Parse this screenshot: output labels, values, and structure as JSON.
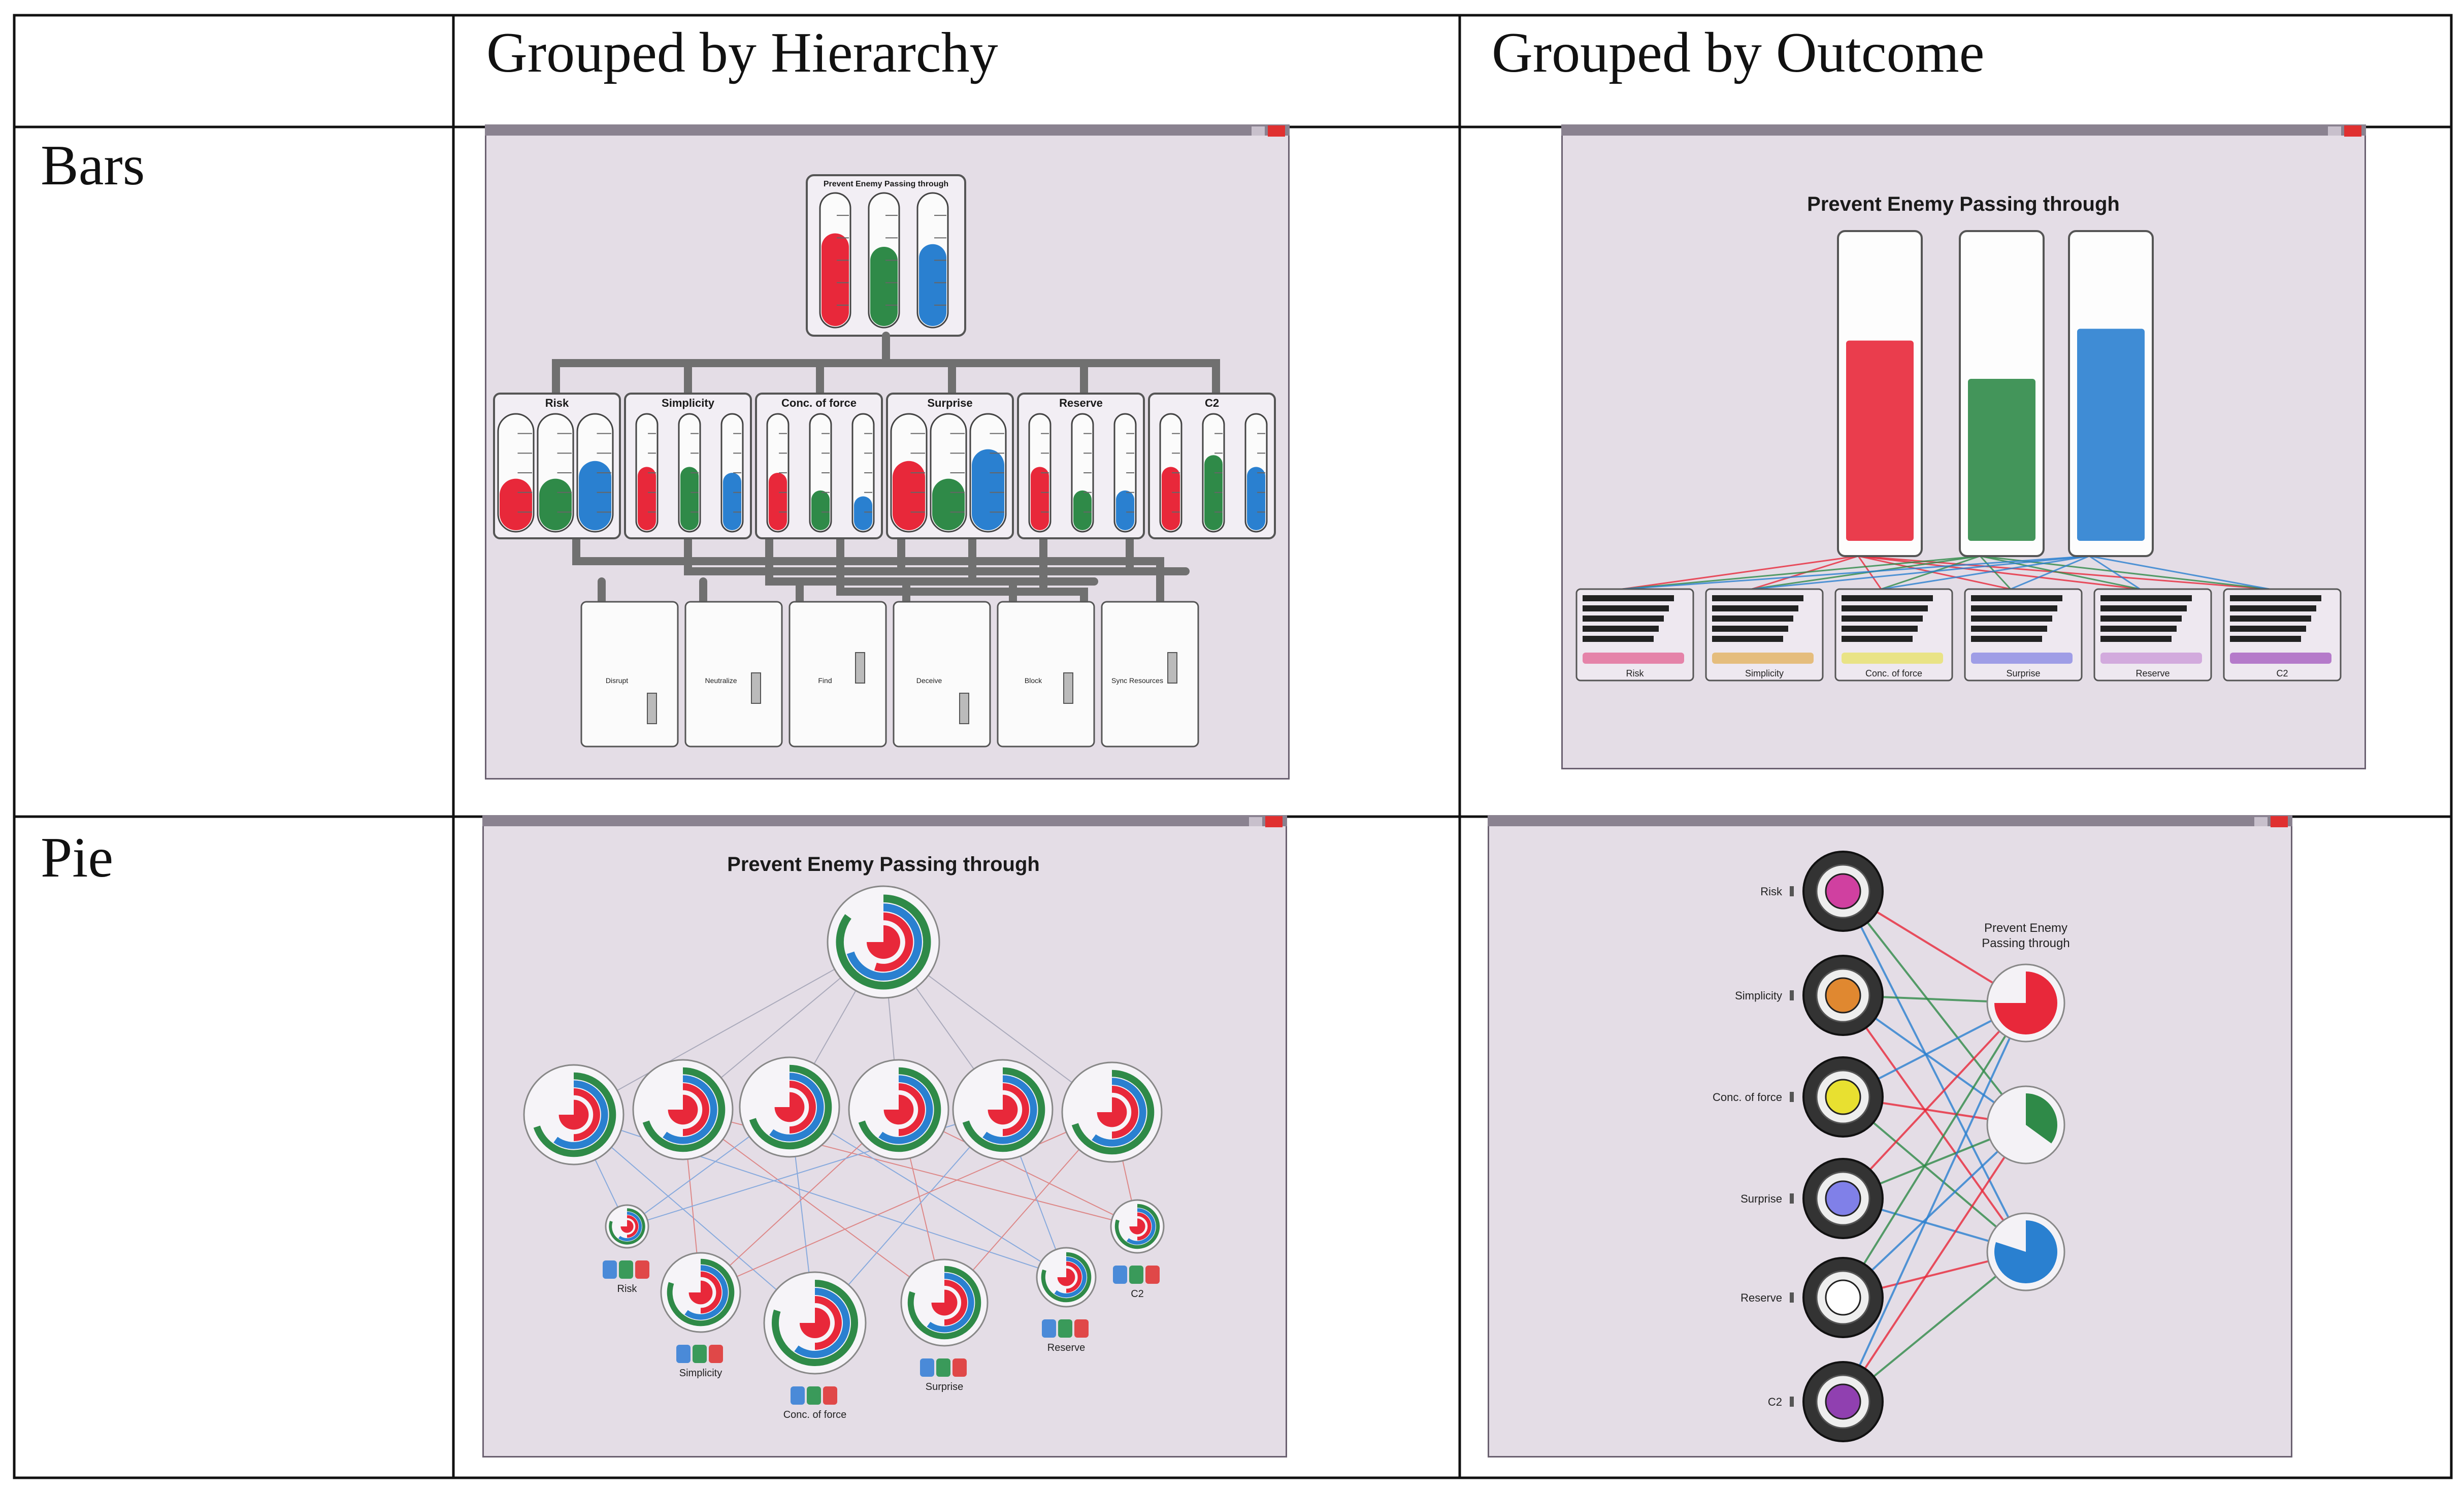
{
  "table": {
    "col_headers": [
      "",
      "Grouped by Hierarchy",
      "Grouped by Outcome"
    ],
    "row_labels": [
      "Bars",
      "Pie"
    ]
  },
  "bars_hierarchy": {
    "root_title": "Prevent Enemy Passing through",
    "root_levels": [
      0.7,
      0.6,
      0.62
    ],
    "principles": [
      {
        "name": "Risk",
        "levels": [
          0.45,
          0.45,
          0.6
        ]
      },
      {
        "name": "Simplicity",
        "levels": [
          0.55,
          0.55,
          0.5
        ]
      },
      {
        "name": "Conc. of force",
        "levels": [
          0.5,
          0.35,
          0.3
        ]
      },
      {
        "name": "Surprise",
        "levels": [
          0.6,
          0.45,
          0.7
        ]
      },
      {
        "name": "Reserve",
        "levels": [
          0.55,
          0.35,
          0.35
        ]
      },
      {
        "name": "C2",
        "levels": [
          0.55,
          0.65,
          0.55
        ]
      }
    ],
    "actions": [
      "Disrupt",
      "Neutralize",
      "Find",
      "Deceive",
      "Block",
      "Sync Resources"
    ]
  },
  "bars_outcome": {
    "title": "Prevent Enemy Passing through",
    "bar_levels": [
      0.68,
      0.55,
      0.72
    ],
    "principles": [
      "Risk",
      "Simplicity",
      "Conc. of force",
      "Surprise",
      "Reserve",
      "C2"
    ],
    "principle_colors": [
      "#e0407a",
      "#e0a030",
      "#e6e040",
      "#6a6ae0",
      "#c080d0",
      "#9030b0"
    ]
  },
  "pie_hierarchy": {
    "title": "Prevent Enemy Passing through",
    "labels": [
      "Risk",
      "Simplicity",
      "Conc. of force",
      "Surprise",
      "Reserve",
      "C2"
    ]
  },
  "pie_outcome": {
    "title_line1": "Prevent Enemy",
    "title_line2": "Passing through",
    "labels": [
      "Risk",
      "Simplicity",
      "Conc. of force",
      "Surprise",
      "Reserve",
      "C2"
    ],
    "ring_colors": [
      "#d040a0",
      "#e08830",
      "#e8e030",
      "#8080e8",
      "#ffffff",
      "#9040b0"
    ],
    "outcome_fills": [
      0.75,
      0.35,
      0.8
    ]
  },
  "colors": {
    "red": "#e8283a",
    "green": "#2f8a48",
    "blue": "#2a80d0",
    "window_bg": "#e4dde6",
    "frame": "#6a6070"
  }
}
